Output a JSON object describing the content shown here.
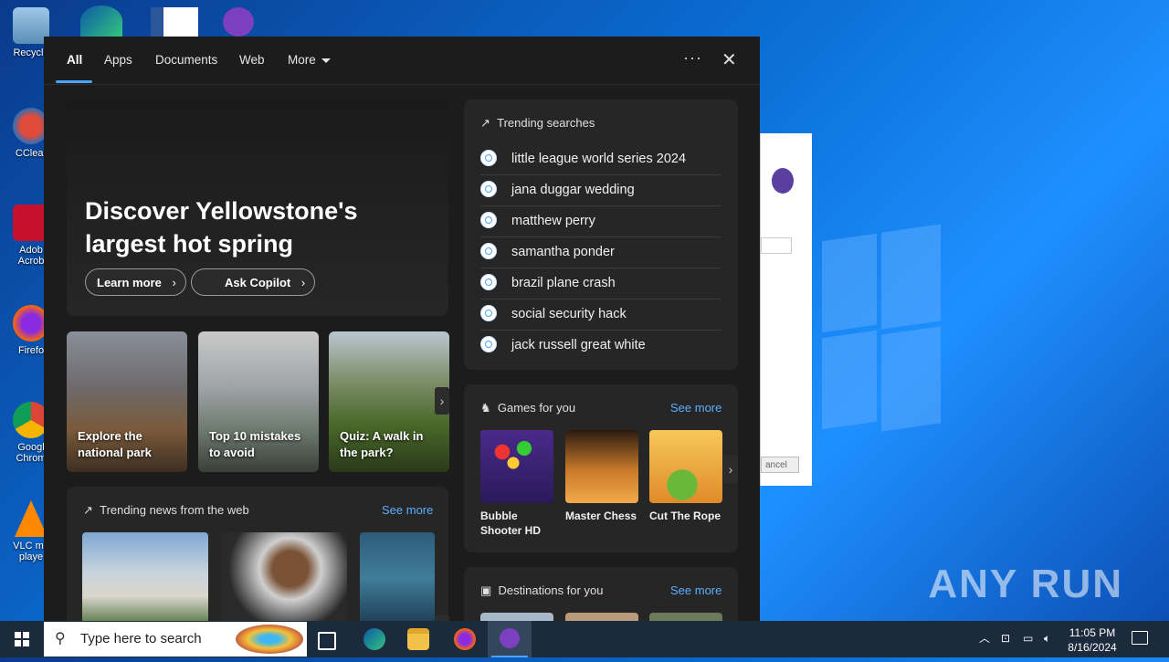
{
  "desktop": {
    "icons": [
      {
        "label": "Recycle"
      },
      {
        "label": "CClear"
      },
      {
        "label": "Adob\nAcrob"
      },
      {
        "label": "Firefo"
      },
      {
        "label": "Googl\nChrom"
      },
      {
        "label": "VLC me\nplaye"
      }
    ],
    "watermark": "ANY RUN",
    "dialog_cancel": "ancel"
  },
  "search_panel": {
    "tabs": [
      "All",
      "Apps",
      "Documents",
      "Web",
      "More"
    ],
    "hero": {
      "title": "Discover Yellowstone's largest hot spring",
      "learn_more": "Learn more",
      "ask_copilot": "Ask Copilot"
    },
    "cards": [
      {
        "caption": "Explore the national park"
      },
      {
        "caption": "Top 10 mistakes to avoid"
      },
      {
        "caption": "Quiz: A walk in the park?"
      }
    ],
    "trending_news": {
      "title": "Trending news from the web",
      "see_more": "See more"
    },
    "trending_searches": {
      "title": "Trending searches",
      "items": [
        "little league world series 2024",
        "jana duggar wedding",
        "matthew perry",
        "samantha ponder",
        "brazil plane crash",
        "social security hack",
        "jack russell great white"
      ]
    },
    "games": {
      "title": "Games for you",
      "see_more": "See more",
      "items": [
        {
          "name": "Bubble Shooter HD"
        },
        {
          "name": "Master Chess"
        },
        {
          "name": "Cut The Rope"
        }
      ]
    },
    "destinations": {
      "title": "Destinations for you",
      "see_more": "See more"
    }
  },
  "taskbar": {
    "search_placeholder": "Type here to search",
    "time": "11:05 PM",
    "date": "8/16/2024"
  },
  "colors": {
    "accent": "#4da3ff",
    "panel_bg": "#1c1c1c",
    "card_bg": "#262626"
  }
}
